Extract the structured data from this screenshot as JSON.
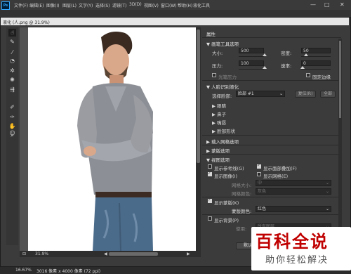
{
  "app": {
    "logo": "Ps"
  },
  "menubar": {
    "items": [
      "文件(F)",
      "编辑(E)",
      "图像(I)",
      "图层(L)",
      "文字(Y)",
      "选择(S)",
      "滤镜(T)",
      "3D(D)",
      "视图(V)",
      "窗口(W)",
      "帮助(H)",
      "液化工具"
    ],
    "window_controls": [
      "—",
      "□",
      "✕"
    ]
  },
  "dialog": {
    "title": "液化 (人.png @ 31.9%)"
  },
  "tools": [
    "forward-warp-tool",
    "reconstruct-tool",
    "smooth-tool",
    "twirl-tool",
    "pucker-tool",
    "bloat-tool",
    "push-left-tool",
    "freeze-mask-tool",
    "thaw-mask-tool",
    "face-tool",
    "hand-tool",
    "zoom-tool"
  ],
  "canvas": {
    "zoom": "31.9%"
  },
  "panel": {
    "title": "属性",
    "brush": {
      "header": "画笔工具选项",
      "size_label": "大小:",
      "size_value": "500",
      "density_label": "密度:",
      "density_value": "50",
      "pressure_label": "压力:",
      "pressure_value": "100",
      "rate_label": "速率:",
      "rate_value": "0",
      "stylus_label": "光笔压力",
      "pin_edges_label": "固定边缘"
    },
    "face": {
      "header": "人脸识别液化",
      "select_label": "选择脸部:",
      "select_value": "脸部 #1",
      "reset_label": "复位(R)",
      "all_label": "全部",
      "items": [
        "眼睛",
        "鼻子",
        "嘴唇",
        "脸部形状"
      ]
    },
    "load_mesh": "载入网格选项",
    "mask": "蒙版选项",
    "view": {
      "header": "视图选项",
      "show_guides": "显示参考线(G)",
      "show_face_overlay": "显示面部叠加(F)",
      "show_image": "显示图像(I)",
      "show_mesh": "显示网格(E)",
      "mesh_size_label": "网格大小:",
      "mesh_size_value": "中",
      "mesh_color_label": "网格颜色:",
      "mesh_color_value": "灰色",
      "show_mask": "显示蒙版(K)",
      "mask_color_label": "蒙版颜色:",
      "mask_color_value": "红色",
      "show_backdrop": "显示背景(P)",
      "use_label": "使用:",
      "use_value": "所有图层"
    },
    "cancel_label": "取消",
    "ok_label": "默认值"
  },
  "status": {
    "zoom": "16.67%",
    "doc": "3016 像素 x 4000 像素 (72 ppi)"
  },
  "watermark": {
    "title": "百科全说",
    "subtitle": "助你轻松解决"
  }
}
